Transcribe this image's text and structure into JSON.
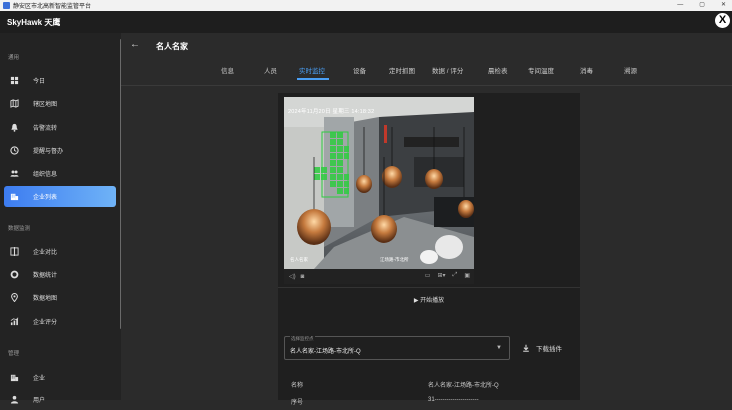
{
  "window": {
    "title": "静安区市北高新智能监管平台",
    "min": "—",
    "max": "▢",
    "close": "✕"
  },
  "header": {
    "brand": "SkyHawk 天鹰",
    "close_icon": "close-icon",
    "close_glyph": "X"
  },
  "sidebar": {
    "sections": [
      {
        "label": "通用",
        "items": [
          {
            "label": "今日",
            "icon": "dashboard-icon"
          },
          {
            "label": "辖区地图",
            "icon": "map-icon"
          },
          {
            "label": "告警流转",
            "icon": "bell-icon"
          },
          {
            "label": "提醒与督办",
            "icon": "clock-icon"
          },
          {
            "label": "组织信息",
            "icon": "people-icon"
          },
          {
            "label": "企业列表",
            "icon": "building-icon",
            "active": true
          }
        ]
      },
      {
        "label": "数据监测",
        "items": [
          {
            "label": "企业对比",
            "icon": "compare-icon"
          },
          {
            "label": "数据统计",
            "icon": "donut-icon"
          },
          {
            "label": "数据地图",
            "icon": "pin-icon"
          },
          {
            "label": "企业评分",
            "icon": "score-icon"
          }
        ]
      },
      {
        "label": "管理",
        "items": [
          {
            "label": "企业",
            "icon": "building-icon"
          },
          {
            "label": "用户",
            "icon": "user-icon"
          }
        ]
      }
    ]
  },
  "main": {
    "back_glyph": "←",
    "title": "名人名家",
    "tabs": [
      {
        "label": "信息"
      },
      {
        "label": "人员"
      },
      {
        "label": "实时监控",
        "active": true
      },
      {
        "label": "设备"
      },
      {
        "label": "定时抓图"
      },
      {
        "label": "数据 / 评分"
      },
      {
        "label": "晨检表"
      },
      {
        "label": "专间温度"
      },
      {
        "label": "消毒"
      },
      {
        "label": "溯源"
      }
    ],
    "video": {
      "timestamp": "2024年11月20日 星期三 14:18:32",
      "overlay_left": "名人名家",
      "overlay_right": "江场路-市北所",
      "toolbar_left": [
        "volume-icon",
        "snapshot-icon"
      ],
      "toolbar_right": [
        "record-icon",
        "layout-icon",
        "fullscreen-icon",
        "settings-icon"
      ],
      "play_label": "▶ 开始播放"
    },
    "info": {
      "select": {
        "label": "选择监控点",
        "value": "名人名家-江场路-市北所-Q",
        "caret": "▼"
      },
      "download_label": "下载插件",
      "rows": [
        {
          "key": "名称",
          "value": "名人名家-江场路-市北所-Q"
        },
        {
          "key": "序号",
          "value": "31----------------------"
        }
      ]
    }
  }
}
